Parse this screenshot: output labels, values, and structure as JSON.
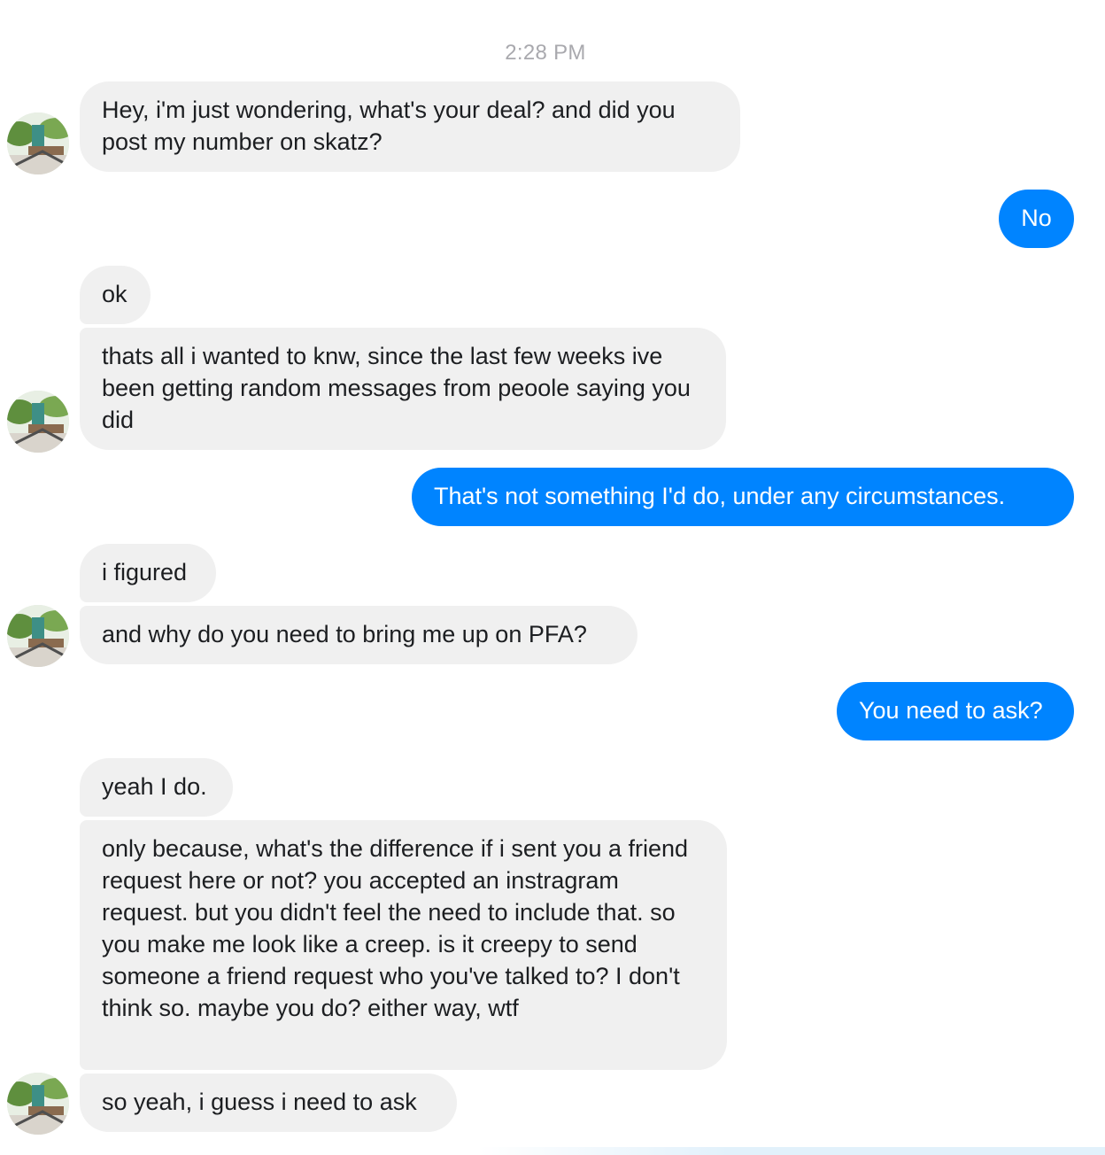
{
  "conversation": {
    "timestamp": "2:28 PM",
    "messages": [
      {
        "id": "m1",
        "sender": "them",
        "text": "Hey, i'm just wondering, what's your deal? and did you post my number on skatz?"
      },
      {
        "id": "m2",
        "sender": "me",
        "text": "No"
      },
      {
        "id": "m3",
        "sender": "them",
        "text": "ok"
      },
      {
        "id": "m4",
        "sender": "them",
        "text": "thats all i wanted to knw, since the last few weeks ive been getting random messages from peoole saying you did"
      },
      {
        "id": "m5",
        "sender": "me",
        "text": "That's not something I'd do, under any circumstances."
      },
      {
        "id": "m6",
        "sender": "them",
        "text": "i figured"
      },
      {
        "id": "m7",
        "sender": "them",
        "text": "and why do you need to bring me up on PFA?"
      },
      {
        "id": "m8",
        "sender": "me",
        "text": "You need to ask?"
      },
      {
        "id": "m9",
        "sender": "them",
        "text": "yeah I do."
      },
      {
        "id": "m10",
        "sender": "them",
        "text": "only because, what's the difference if i sent you a friend request here or not? you accepted an instragram request. but you didn't feel the need to include that. so you make me look like a creep. is it creepy to send someone a friend request who you've talked to? I don't think so. maybe you do? either way, wtf"
      },
      {
        "id": "m11",
        "sender": "them",
        "text": "so yeah, i guess i need to ask"
      }
    ]
  },
  "icons": {
    "avatar": "contact-avatar-icon"
  },
  "colors": {
    "outgoing_bubble": "#0084ff",
    "incoming_bubble": "#f0f0f0",
    "timestamp": "#a9a9ae"
  }
}
